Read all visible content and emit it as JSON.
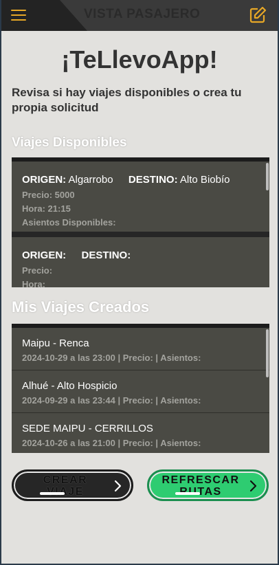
{
  "header": {
    "title": "VISTA PASAJERO",
    "menu_icon": "hamburger-menu-icon",
    "edit_icon": "edit-note-icon",
    "accent_color": "#e8a826"
  },
  "main": {
    "app_title": "¡TeLlevoApp!",
    "subtitle": "Revisa si hay viajes disponibles o crea tu propia solicitud"
  },
  "available_section": {
    "title": "Viajes Disponibles",
    "origin_label": "ORIGEN:",
    "destination_label": "DESTINO:",
    "trips": [
      {
        "origin": "Algarrobo",
        "destination": "Alto Biobío",
        "price": "Precio: 5000",
        "time": "Hora: 21:15",
        "seats": "Asientos Disponibles:"
      },
      {
        "origin": "",
        "destination": "",
        "price": "Precio:",
        "time": "Hora:",
        "seats": ""
      }
    ]
  },
  "created_section": {
    "title": "Mis Viajes Creados",
    "trips": [
      {
        "name": "Maipu - Renca",
        "info": "2024-10-29 a las 23:00 | Precio: | Asientos:"
      },
      {
        "name": "Alhué - Alto Hospicio",
        "info": "2024-09-29 a las 23:44 | Precio: | Asientos:"
      },
      {
        "name": "SEDE MAIPU - CERRILLOS",
        "info": "2024-10-26 a las 21:00 | Precio: | Asientos:"
      }
    ]
  },
  "buttons": {
    "create": {
      "line1": "CREAR",
      "line2": "VIAJE",
      "icon": "chevron-right-icon"
    },
    "refresh": {
      "line1": "REFRESCAR",
      "line2": "RUTAS",
      "icon": "chevron-right-icon",
      "color": "#2ecc71"
    }
  }
}
